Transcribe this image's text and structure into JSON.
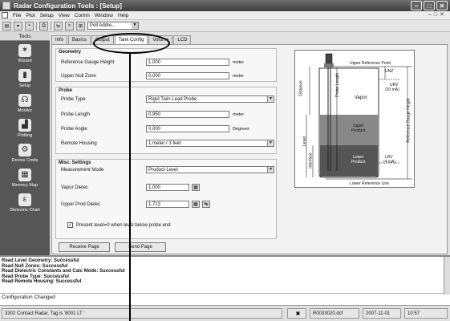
{
  "window": {
    "title": "Radar Configuration Tools : [Setup]"
  },
  "menu": [
    "File",
    "Plot",
    "Setup",
    "View",
    "Comm",
    "Window",
    "Help"
  ],
  "toolbar": {
    "address_combo": "Poll Addre..."
  },
  "sidebar": {
    "header": "Tools",
    "items": [
      {
        "label": "Wizard",
        "icon": "wizard-icon",
        "glyph": "✶"
      },
      {
        "label": "Setup",
        "icon": "setup-icon",
        "glyph": "▮"
      },
      {
        "label": "Monitor",
        "icon": "monitor-icon",
        "glyph": "☊"
      },
      {
        "label": "Plotting",
        "icon": "plotting-icon",
        "glyph": "▟"
      },
      {
        "label": "Device Cmds",
        "icon": "device-cmds-icon",
        "glyph": "⚙"
      },
      {
        "label": "Memory Map",
        "icon": "memory-map-icon",
        "glyph": "▦"
      },
      {
        "label": "Dielectric Chart",
        "icon": "dielectric-chart-icon",
        "glyph": "ε"
      }
    ]
  },
  "tabs": [
    "Info",
    "Basics",
    "Output",
    "Tank Config",
    "Volume",
    "LCD"
  ],
  "active_tab": "Tank Config",
  "geometry": {
    "title": "Geometry",
    "ref_gauge_height": {
      "label": "Reference Gauge Height",
      "value": "1,000",
      "unit": "meter"
    },
    "upper_null_zone": {
      "label": "Upper Null Zone",
      "value": "0,000",
      "unit": "meter"
    }
  },
  "probe": {
    "title": "Probe",
    "type": {
      "label": "Probe Type",
      "value": "Rigid Twin Lead Probe"
    },
    "length": {
      "label": "Probe Length",
      "value": "0,950",
      "unit": "meter"
    },
    "angle": {
      "label": "Probe Angle",
      "value": "0,000",
      "unit": "Degrees"
    },
    "remote_housing": {
      "label": "Remote Housing",
      "value": "1 meter / 3 feet"
    }
  },
  "misc": {
    "title": "Misc. Settings",
    "measurement_mode": {
      "label": "Measurement Mode",
      "value": "Product Level"
    },
    "vapor_dielec": {
      "label": "Vapor Dielec",
      "value": "1,000"
    },
    "upper_prod_dielec": {
      "label": "Upper Prod Dielec",
      "value": "1,713"
    },
    "present_level_check": {
      "label": "Present level=0 when level below probe end",
      "checked": true
    }
  },
  "buttons": {
    "receive": "Receive Page",
    "send": "Send Page"
  },
  "diagram": {
    "upper_ref_point": "Upper Reference Point",
    "unz": "UNZ",
    "urv": "URV",
    "urv_sub": "(20 mA)",
    "vapor": "Vapor",
    "upper_product": "Upper",
    "upper_product_2": "Product",
    "lower_product": "Lower",
    "lower_product_2": "Product",
    "lrv": "LRV",
    "lrv_sub": "(4 mA)",
    "lower_ref_line": "Lower Reference Line",
    "distance": "Distance",
    "probe_length": "Probe Length",
    "level": "Level",
    "interface": "Interface",
    "ref_gauge_height": "Reference Gauge Height"
  },
  "log": {
    "lines": [
      "Read Level Geometry: Successful",
      "Read Null Zones: Successful",
      "Read Dielectric Constants and Calc Mode: Successful",
      "Read Probe Type: Successful",
      "Read Remote Housing: Successful"
    ],
    "status_message": "Configuration Changed"
  },
  "statusbar": {
    "device": "3302 Contact Radar,  Tag is '8001 LT '",
    "file": "R0033020.dcf",
    "date": "2007-11-01",
    "time": "10:57"
  }
}
